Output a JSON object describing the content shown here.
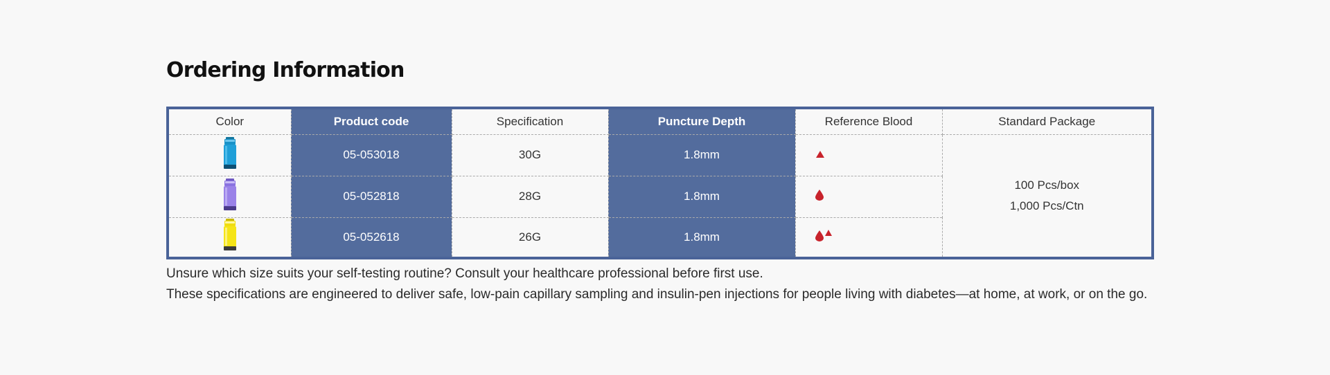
{
  "page": {
    "title": "Ordering Information"
  },
  "table": {
    "headers": [
      "Color",
      "Product code",
      "Specification",
      "Puncture Depth",
      "Reference Blood",
      "Standard Package"
    ],
    "rows": [
      {
        "color": "blue",
        "vial_color": "#1f9fd8",
        "code": "05-053018",
        "spec": "30G",
        "depth": "1.8mm",
        "blood_icon": "blood-triangle-icon"
      },
      {
        "color": "purple",
        "vial_color": "#9a82e8",
        "code": "05-052818",
        "spec": "28G",
        "depth": "1.8mm",
        "blood_icon": "blood-drop-icon"
      },
      {
        "color": "yellow",
        "vial_color": "#f5e417",
        "code": "05-052618",
        "spec": "26G",
        "depth": "1.8mm",
        "blood_icon": "blood-drop-triangle-icon"
      }
    ],
    "package_line1": "100 Pcs/box",
    "package_line2": "1,000 Pcs/Ctn"
  },
  "notes": {
    "line1": "Unsure which size suits your self-testing routine? Consult your healthcare professional before first use.",
    "line2": "These specifications are engineered to deliver safe, low-pain capillary sampling and insulin-pen injections for people living with diabetes—at home, at work, or on the go."
  },
  "colors": {
    "header_highlight": "#536c9d",
    "border": "#4a6398",
    "blood": "#c8232c"
  }
}
